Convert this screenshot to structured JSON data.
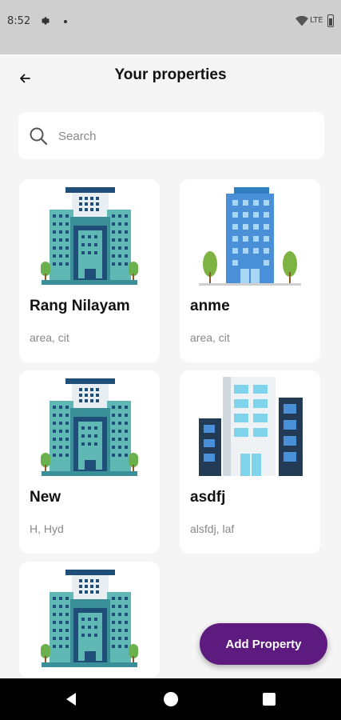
{
  "status_bar": {
    "time": "8:52",
    "network_label": "LTE",
    "icons": [
      "gear-icon",
      "notification-dot-icon",
      "wifi-icon",
      "battery-icon"
    ]
  },
  "header": {
    "title": "Your properties",
    "back_icon": "arrow-left-icon"
  },
  "search": {
    "placeholder": "Search",
    "icon": "search-icon"
  },
  "properties": [
    {
      "name": "Rang Nilayam",
      "location": "area, cit",
      "illustration": "apartment-complex-illustration"
    },
    {
      "name": "anme",
      "location": "area, cit",
      "illustration": "blue-tower-illustration"
    },
    {
      "name": "New",
      "location": "H, Hyd",
      "illustration": "apartment-complex-illustration"
    },
    {
      "name": "asdfj",
      "location": "alsfdj, laf",
      "illustration": "office-building-illustration"
    },
    {
      "name": "",
      "location": "",
      "illustration": "apartment-complex-illustration"
    }
  ],
  "fab": {
    "label": "Add Property"
  },
  "colors": {
    "fab_background": "#5e1b7f",
    "page_background": "#f5f5f5",
    "status_bar": "#cfcfcf"
  }
}
